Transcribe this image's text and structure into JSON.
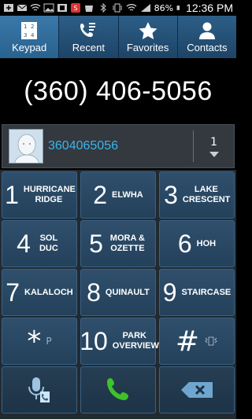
{
  "status": {
    "battery": "86%",
    "time": "12:36 PM"
  },
  "tabs": [
    {
      "label": "Keypad",
      "icon": "keypad-icon"
    },
    {
      "label": "Recent",
      "icon": "recent-calls-icon"
    },
    {
      "label": "Favorites",
      "icon": "star-icon"
    },
    {
      "label": "Contacts",
      "icon": "person-icon"
    }
  ],
  "display": {
    "number": "(360) 406-5056"
  },
  "suggestion": {
    "number": "3604065056",
    "count": "1"
  },
  "keys": [
    {
      "digit": "1",
      "letters": "HURRICANE RIDGE"
    },
    {
      "digit": "2",
      "letters": "ELWHA"
    },
    {
      "digit": "3",
      "letters": "LAKE CRESCENT"
    },
    {
      "digit": "4",
      "letters": "SOL DUC"
    },
    {
      "digit": "5",
      "letters": "MORA & OZETTE"
    },
    {
      "digit": "6",
      "letters": "HOH"
    },
    {
      "digit": "7",
      "letters": "KALALOCH"
    },
    {
      "digit": "8",
      "letters": "QUINAULT"
    },
    {
      "digit": "9",
      "letters": "STAIRCASE"
    },
    {
      "digit": "*",
      "letters": "P"
    },
    {
      "digit": "10",
      "letters": "PARK OVERVIEW"
    },
    {
      "digit": "#",
      "letters": ""
    }
  ],
  "colors": {
    "accent": "#3cb4e8",
    "call_green": "#3fc22a",
    "delete_blue": "#6fa6cf"
  }
}
